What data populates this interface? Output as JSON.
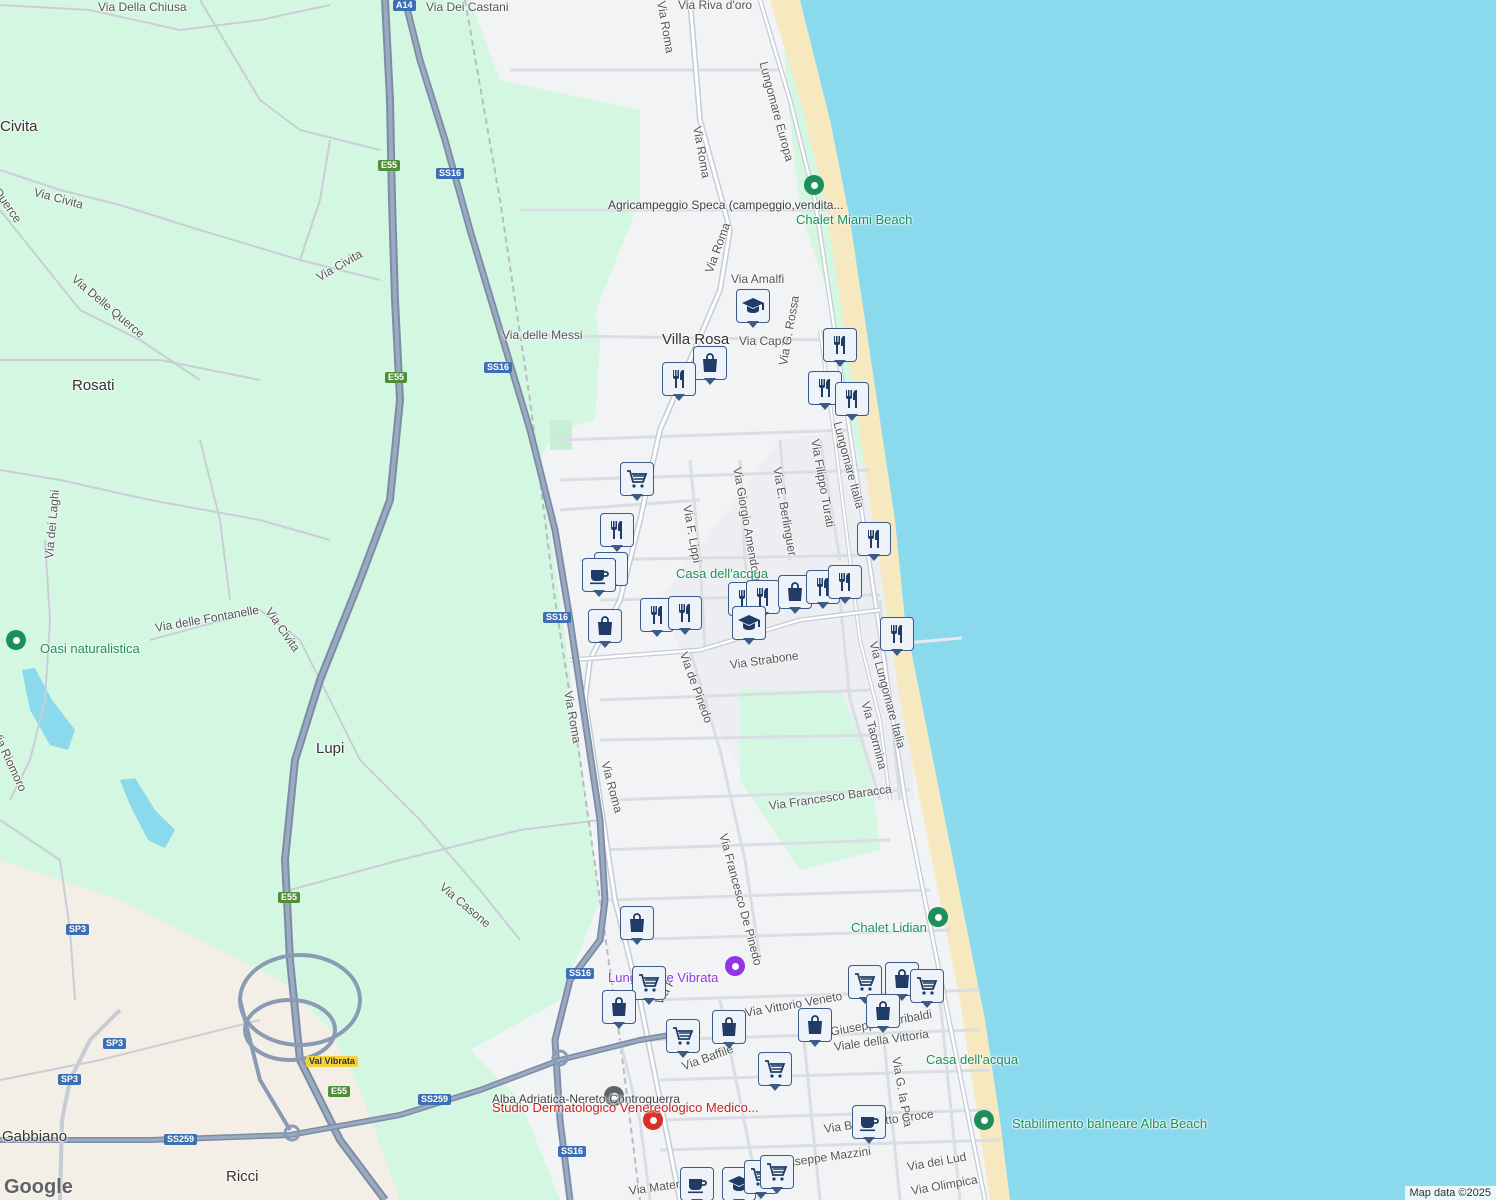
{
  "map": {
    "attribution": "Map data ©2025",
    "logo": "Google",
    "colors": {
      "sea": "#8ad9ec",
      "land": "#f5f5f5",
      "green": "#d4f7e2",
      "beach": "#f6e8bf",
      "motorway": "#8a9bb5",
      "road": "#d5dae3"
    }
  },
  "labels": {
    "places": [
      {
        "text": "Civita"
      },
      {
        "text": "Rosati"
      },
      {
        "text": "Lupi"
      },
      {
        "text": "Villa Rosa"
      },
      {
        "text": "Gabbiano"
      },
      {
        "text": "Ricci"
      }
    ],
    "streets": [
      {
        "text": "Via Della Chiusa"
      },
      {
        "text": "Via Dei Castani"
      },
      {
        "text": "Via Riva d'oro"
      },
      {
        "text": "Via Roma"
      },
      {
        "text": "Via Roma"
      },
      {
        "text": "Via Roma"
      },
      {
        "text": "Via Roma"
      },
      {
        "text": "Via Roma"
      },
      {
        "text": "Lungomare Europa"
      },
      {
        "text": "Via Civita"
      },
      {
        "text": "Via Civita"
      },
      {
        "text": "Via Civita"
      },
      {
        "text": "Querce"
      },
      {
        "text": "Via Delle Querce"
      },
      {
        "text": "Via delle Messi"
      },
      {
        "text": "Via Amalfi"
      },
      {
        "text": "Via Capri"
      },
      {
        "text": "Via G. Rossa"
      },
      {
        "text": "Lungomare Italia"
      },
      {
        "text": "Via Filippo Turati"
      },
      {
        "text": "Via E. Berlinguer"
      },
      {
        "text": "Via Giorgio Amendola"
      },
      {
        "text": "Via F. Lippi"
      },
      {
        "text": "Via dei Laghi"
      },
      {
        "text": "Via delle Fontanelle"
      },
      {
        "text": "Via Strabone"
      },
      {
        "text": "Via de Pinedo"
      },
      {
        "text": "Via Taormina"
      },
      {
        "text": "Via Francesco Baracca"
      },
      {
        "text": "Via Francesco De Pinedo"
      },
      {
        "text": "Via Casone"
      },
      {
        "text": "Via Riomoro"
      },
      {
        "text": "Via Baffile"
      },
      {
        "text": "Viale della Vittoria"
      },
      {
        "text": "Viale Giuseppe Garibaldi"
      },
      {
        "text": "Via G. la Pira"
      },
      {
        "text": "Via Benedetto Croce"
      },
      {
        "text": "Via Giuseppe Mazzini"
      },
      {
        "text": "Via dei Lud"
      },
      {
        "text": "Via Olimpica"
      },
      {
        "text": "Via Maternità"
      },
      {
        "text": "Via F"
      },
      {
        "text": "Via Lungomare Italia"
      },
      {
        "text": "Via Vittorio Veneto"
      }
    ],
    "shields": [
      {
        "text": "A14",
        "kind": "blue"
      },
      {
        "text": "E55",
        "kind": "green"
      },
      {
        "text": "E55",
        "kind": "green"
      },
      {
        "text": "E55",
        "kind": "green"
      },
      {
        "text": "E55",
        "kind": "green"
      },
      {
        "text": "SS16",
        "kind": "blue"
      },
      {
        "text": "SS16",
        "kind": "blue"
      },
      {
        "text": "SS16",
        "kind": "blue"
      },
      {
        "text": "SS16",
        "kind": "blue"
      },
      {
        "text": "SS16",
        "kind": "blue"
      },
      {
        "text": "SP3",
        "kind": "blue"
      },
      {
        "text": "SP3",
        "kind": "blue"
      },
      {
        "text": "SP3",
        "kind": "blue"
      },
      {
        "text": "SS259",
        "kind": "blue"
      },
      {
        "text": "SS259",
        "kind": "blue"
      },
      {
        "text": "Val Vibrata",
        "kind": "yellow"
      }
    ],
    "pois": [
      {
        "text": "Chalet Miami Beach",
        "color": "green"
      },
      {
        "text": "Agricampeggio Speca (campeggio,vendita...",
        "color": "dark"
      },
      {
        "text": "Casa dell'acqua",
        "color": "green"
      },
      {
        "text": "Oasi naturalistica",
        "color": "green"
      },
      {
        "text": "Chalet Lidian",
        "color": "green"
      },
      {
        "text": "Lungomare Vibrata",
        "color": "purple"
      },
      {
        "text": "Casa dell'acqua",
        "color": "green"
      },
      {
        "text": "Alba Adriatica-Nereto-Controguerra",
        "color": "dark"
      },
      {
        "text": "Studio Dermatologico Venereologico Medico...",
        "color": "red"
      },
      {
        "text": "Stabilimento balneare Alba Beach",
        "color": "green"
      }
    ]
  },
  "markers": [
    {
      "icon": "school-icon"
    },
    {
      "icon": "restaurant-icon"
    },
    {
      "icon": "shopping-bag-icon"
    },
    {
      "icon": "restaurant-icon"
    },
    {
      "icon": "restaurant-icon"
    },
    {
      "icon": "restaurant-icon"
    },
    {
      "icon": "cart-icon"
    },
    {
      "icon": "restaurant-icon"
    },
    {
      "icon": "restaurant-icon"
    },
    {
      "icon": "cafe-icon"
    },
    {
      "icon": "restaurant-icon"
    },
    {
      "icon": "shopping-bag-icon"
    },
    {
      "icon": "restaurant-icon"
    },
    {
      "icon": "restaurant-icon"
    },
    {
      "icon": "restaurant-icon"
    },
    {
      "icon": "restaurant-icon"
    },
    {
      "icon": "shopping-bag-icon"
    },
    {
      "icon": "restaurant-icon"
    },
    {
      "icon": "restaurant-icon"
    },
    {
      "icon": "school-icon"
    },
    {
      "icon": "restaurant-icon"
    },
    {
      "icon": "shopping-bag-icon"
    },
    {
      "icon": "cart-icon"
    },
    {
      "icon": "shopping-bag-icon"
    },
    {
      "icon": "cart-icon"
    },
    {
      "icon": "shopping-bag-icon"
    },
    {
      "icon": "cart-icon"
    },
    {
      "icon": "cart-icon"
    },
    {
      "icon": "shopping-bag-icon"
    },
    {
      "icon": "cart-icon"
    },
    {
      "icon": "shopping-bag-icon"
    },
    {
      "icon": "shopping-bag-icon"
    },
    {
      "icon": "cafe-icon"
    },
    {
      "icon": "cafe-icon"
    },
    {
      "icon": "school-icon"
    },
    {
      "icon": "cart-icon"
    },
    {
      "icon": "cart-icon"
    }
  ]
}
